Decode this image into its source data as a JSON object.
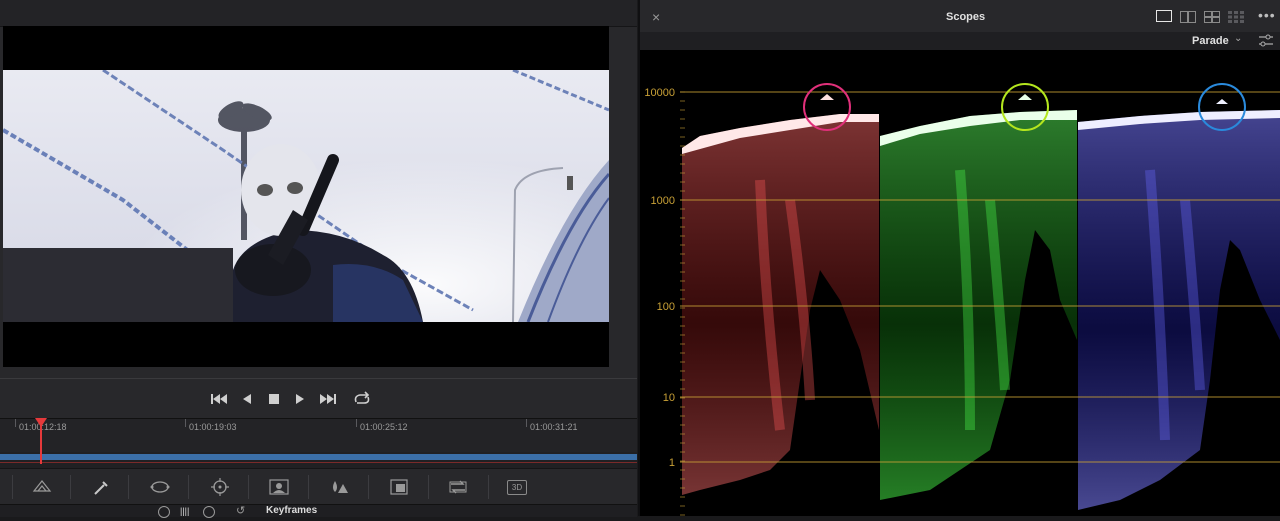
{
  "viewer": {
    "transport": {
      "go_start_icon": "skip-to-start-icon",
      "play_reverse_icon": "play-reverse-icon",
      "stop_icon": "stop-icon",
      "play_icon": "play-icon",
      "go_end_icon": "skip-to-end-icon",
      "loop_icon": "loop-icon"
    },
    "timecodes": [
      "01:00:12:18",
      "01:00:19:03",
      "01:00:25:12",
      "01:00:31:21"
    ],
    "tools": [
      "node-graph-icon",
      "eyedropper-icon",
      "window-icon",
      "tracker-icon",
      "magic-mask-icon",
      "blur-icon",
      "key-icon",
      "resize-icon",
      "3d-icon"
    ],
    "tool_3d_label": "3D",
    "bottom_label": "Keyframes"
  },
  "scopes": {
    "close_label": "×",
    "title": "Scopes",
    "mode": "Parade",
    "mode_dropdown_icon": "chevron-down-icon",
    "more_icon": "more-icon",
    "settings_icon": "settings-icon",
    "layout_icons": [
      "single-view-icon",
      "dual-view-icon",
      "quad-view-icon",
      "grid-view-icon"
    ],
    "scale_labels": [
      "10000",
      "1000",
      "100",
      "10",
      "1"
    ],
    "channels": [
      {
        "name": "R",
        "color": "#ff5a5a"
      },
      {
        "name": "G",
        "color": "#4cff4c"
      },
      {
        "name": "B",
        "color": "#6a6aff"
      }
    ],
    "highlight_circle_colors": [
      "#e0307a",
      "#b4e61e",
      "#2a8adc"
    ],
    "grid_color": "#c8a036"
  }
}
